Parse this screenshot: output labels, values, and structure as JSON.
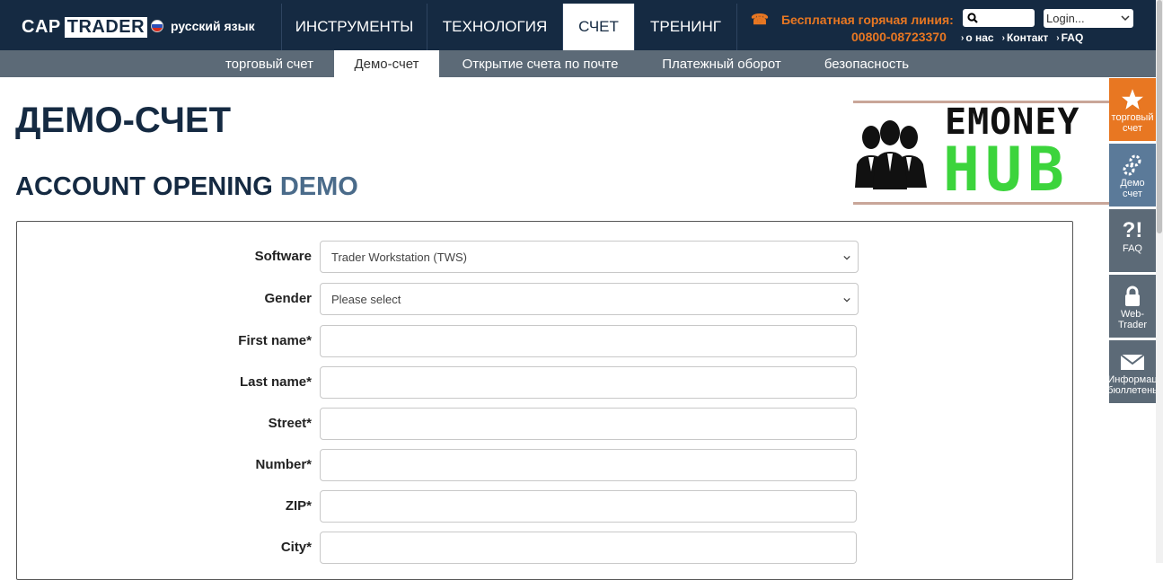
{
  "header": {
    "logo_cap": "CAP",
    "logo_trader": "TRADER",
    "language": "русский язык",
    "nav": [
      {
        "label": "ИНСТРУМЕНТЫ",
        "active": false
      },
      {
        "label": "ТЕХНОЛОГИЯ",
        "active": false
      },
      {
        "label": "СЧЕТ",
        "active": true
      },
      {
        "label": "ТРЕНИНГ",
        "active": false
      }
    ],
    "hotline_label": "Бесплатная горячая линия:",
    "hotline_number": "00800-08723370",
    "login_placeholder": "Login...",
    "links": [
      "о нас",
      "Контакт",
      "FAQ"
    ]
  },
  "subnav": [
    {
      "label": "торговый счет",
      "active": false
    },
    {
      "label": "Демо-счет",
      "active": true
    },
    {
      "label": "Открытие счета по почте",
      "active": false
    },
    {
      "label": "Платежный оборот",
      "active": false
    },
    {
      "label": "безопасность",
      "active": false
    }
  ],
  "page": {
    "title": "ДЕМО-СЧЕТ",
    "subtitle_main": "ACCOUNT OPENING ",
    "subtitle_accent": "DEMO"
  },
  "banner": {
    "line1": "EMONEY",
    "line2": "HUB"
  },
  "form": {
    "fields": [
      {
        "label": "Software",
        "type": "select",
        "value": "Trader Workstation (TWS)"
      },
      {
        "label": "Gender",
        "type": "select",
        "value": "Please select"
      },
      {
        "label": "First name*",
        "type": "input",
        "value": ""
      },
      {
        "label": "Last name*",
        "type": "input",
        "value": ""
      },
      {
        "label": "Street*",
        "type": "input",
        "value": ""
      },
      {
        "label": "Number*",
        "type": "input",
        "value": ""
      },
      {
        "label": "ZIP*",
        "type": "input",
        "value": ""
      },
      {
        "label": "City*",
        "type": "input",
        "value": ""
      }
    ]
  },
  "side_widgets": [
    {
      "label": "торговый счет",
      "icon": "star-icon",
      "color": "#e87722"
    },
    {
      "label": "Демо счет",
      "icon": "gears-icon",
      "color": "#5b7a99"
    },
    {
      "label": "FAQ",
      "icon": "question-icon",
      "color": "#5c6a77"
    },
    {
      "label": "Web-Trader",
      "icon": "lock-icon",
      "color": "#5c6a77"
    },
    {
      "label": "Информац бюллетень",
      "icon": "envelope-icon",
      "color": "#5c6a77"
    }
  ],
  "colors": {
    "header_bg": "#152a42",
    "subnav_bg": "#5c6a77",
    "accent_orange": "#e87722",
    "banner_green": "#3cd43c"
  }
}
